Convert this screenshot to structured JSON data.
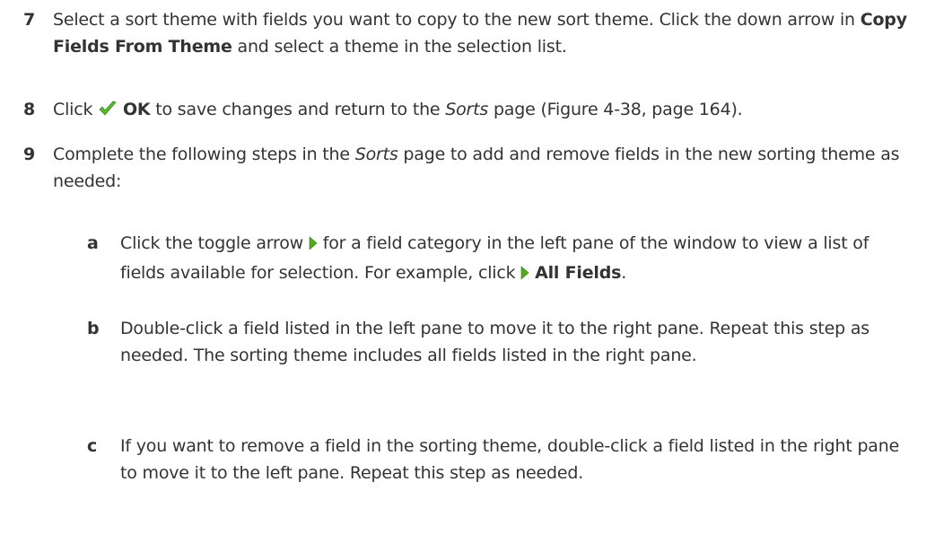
{
  "steps": [
    {
      "number": "7",
      "parts": {
        "a": "Select a sort theme with fields you want to copy to the new sort theme. Click the down arrow in ",
        "b": "Copy Fields From Theme",
        "c": " and select a theme in the selection list."
      }
    },
    {
      "number": "8",
      "parts": {
        "a": "Click ",
        "icon": "checkmark-icon",
        "b": "OK",
        "c": " to save changes and return to the ",
        "d": "Sorts",
        "e": " page (Figure 4-38, page 164)."
      }
    },
    {
      "number": "9",
      "parts": {
        "a": "Complete the following steps in the ",
        "b": "Sorts",
        "c": " page to add and remove fields in the new sorting theme as needed:"
      }
    }
  ],
  "substeps": [
    {
      "letter": "a",
      "parts": {
        "a": "Click the toggle arrow ",
        "icon": "toggle-arrow-icon",
        "b": " for a field category in the left pane of the window to view a list of fields available for selection. For example, click ",
        "c": "All Fields",
        "d": "."
      }
    },
    {
      "letter": "b",
      "parts": {
        "a": "Double-click a field listed in the left pane to move it to the right pane. Repeat this step as needed. The sorting theme includes all fields listed in the right pane."
      }
    },
    {
      "letter": "c",
      "parts": {
        "a": "If you want to remove a field in the sorting theme, double-click a field listed in the right pane to move it to the left pane. Repeat this step as needed."
      }
    }
  ],
  "colors": {
    "text": "#333333",
    "check_green": "#5cb82e",
    "arrow_green": "#4caf1a"
  }
}
